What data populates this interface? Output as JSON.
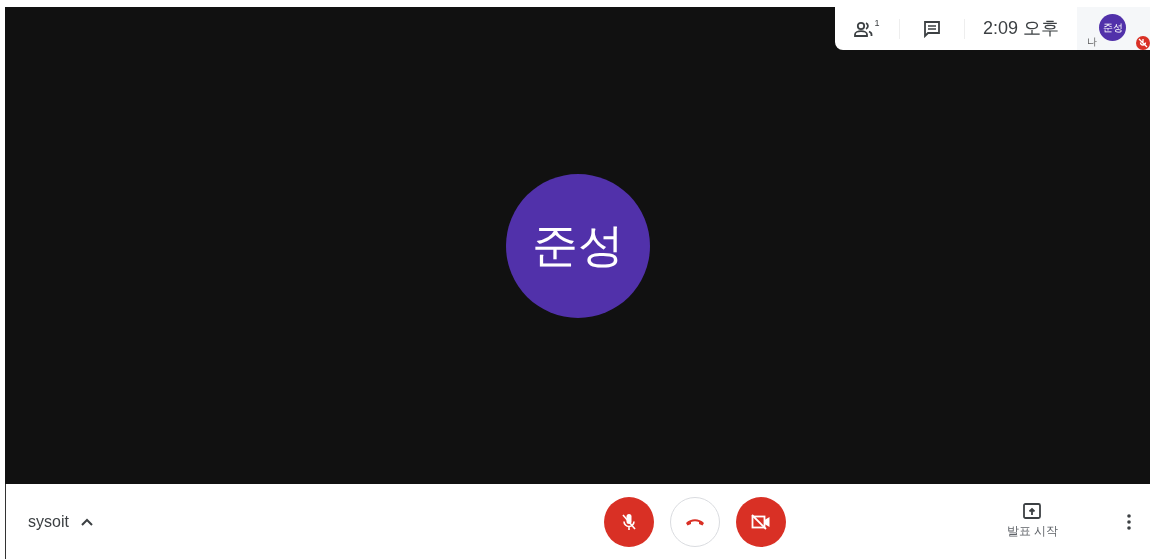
{
  "top_panel": {
    "participants_count": "1",
    "time": "2:09 오후",
    "self_label": "나",
    "self_avatar": "준성",
    "self_muted": true
  },
  "stage": {
    "avatar": "준성"
  },
  "bottom_bar": {
    "meeting_name": "sysoit",
    "controls": [
      {
        "kind": "mic",
        "on": false
      },
      {
        "kind": "hangup"
      },
      {
        "kind": "camera",
        "on": false
      }
    ],
    "present_label": "발표 시작"
  }
}
